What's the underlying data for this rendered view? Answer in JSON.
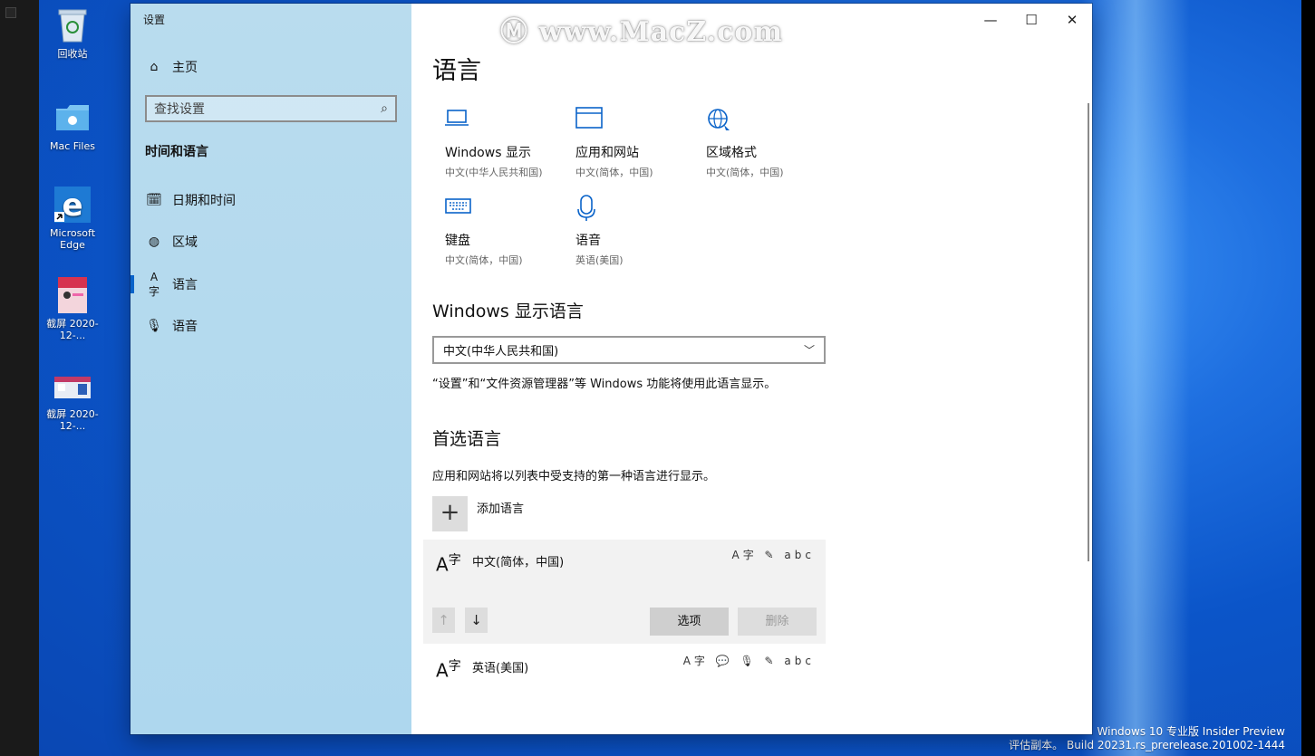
{
  "desktop": {
    "icons": [
      {
        "label": "回收站",
        "icon": "recycle-bin-icon"
      },
      {
        "label": "Mac Files",
        "icon": "mac-folder-icon"
      },
      {
        "label": "Microsoft Edge",
        "icon": "edge-icon"
      },
      {
        "label": "截屏 2020-12-...",
        "icon": "screenshot-thumbnail"
      },
      {
        "label": "截屏 2020-12-...",
        "icon": "screenshot-thumbnail"
      }
    ],
    "build_line1": "Windows 10 专业版 Insider Preview",
    "build_line2": "评估副本。 Build 20231.rs_prerelease.201002-1444"
  },
  "window": {
    "app_title": "设置",
    "watermark": "www.MacZ.com",
    "caption": {
      "minimize": "—",
      "maximize": "☐",
      "close": "✕"
    }
  },
  "nav": {
    "home": "主页",
    "search_placeholder": "查找设置",
    "section": "时间和语言",
    "items": [
      {
        "label": "日期和时间",
        "icon": "calendar-clock-icon",
        "active": false
      },
      {
        "label": "区域",
        "icon": "globe-icon",
        "active": false
      },
      {
        "label": "语言",
        "icon": "language-icon",
        "active": true
      },
      {
        "label": "语音",
        "icon": "microphone-icon",
        "active": false
      }
    ]
  },
  "main": {
    "title": "语言",
    "tiles": [
      {
        "name": "Windows 显示",
        "sub": "中文(中华人民共和国)",
        "icon": "monitor-icon"
      },
      {
        "name": "应用和网站",
        "sub": "中文(简体，中国)",
        "icon": "browser-window-icon"
      },
      {
        "name": "区域格式",
        "sub": "中文(简体，中国)",
        "icon": "region-globe-icon"
      },
      {
        "name": "键盘",
        "sub": "中文(简体，中国)",
        "icon": "keyboard-icon"
      },
      {
        "name": "语音",
        "sub": "英语(美国)",
        "icon": "microphone-icon"
      }
    ],
    "display_language": {
      "heading": "Windows 显示语言",
      "selected": "中文(中华人民共和国)",
      "description": "“设置”和“文件资源管理器”等 Windows 功能将使用此语言显示。"
    },
    "preferred": {
      "heading": "首选语言",
      "description": "应用和网站将以列表中受支持的第一种语言进行显示。",
      "add_label": "添加语言",
      "languages": [
        {
          "name": "中文(简体，中国)",
          "features": "A字 ✎ abc"
        },
        {
          "name": "英语(美国)",
          "features": "A字 💬 🎙 ✎ abc"
        }
      ],
      "options_button": "选项",
      "remove_button": "删除"
    }
  }
}
